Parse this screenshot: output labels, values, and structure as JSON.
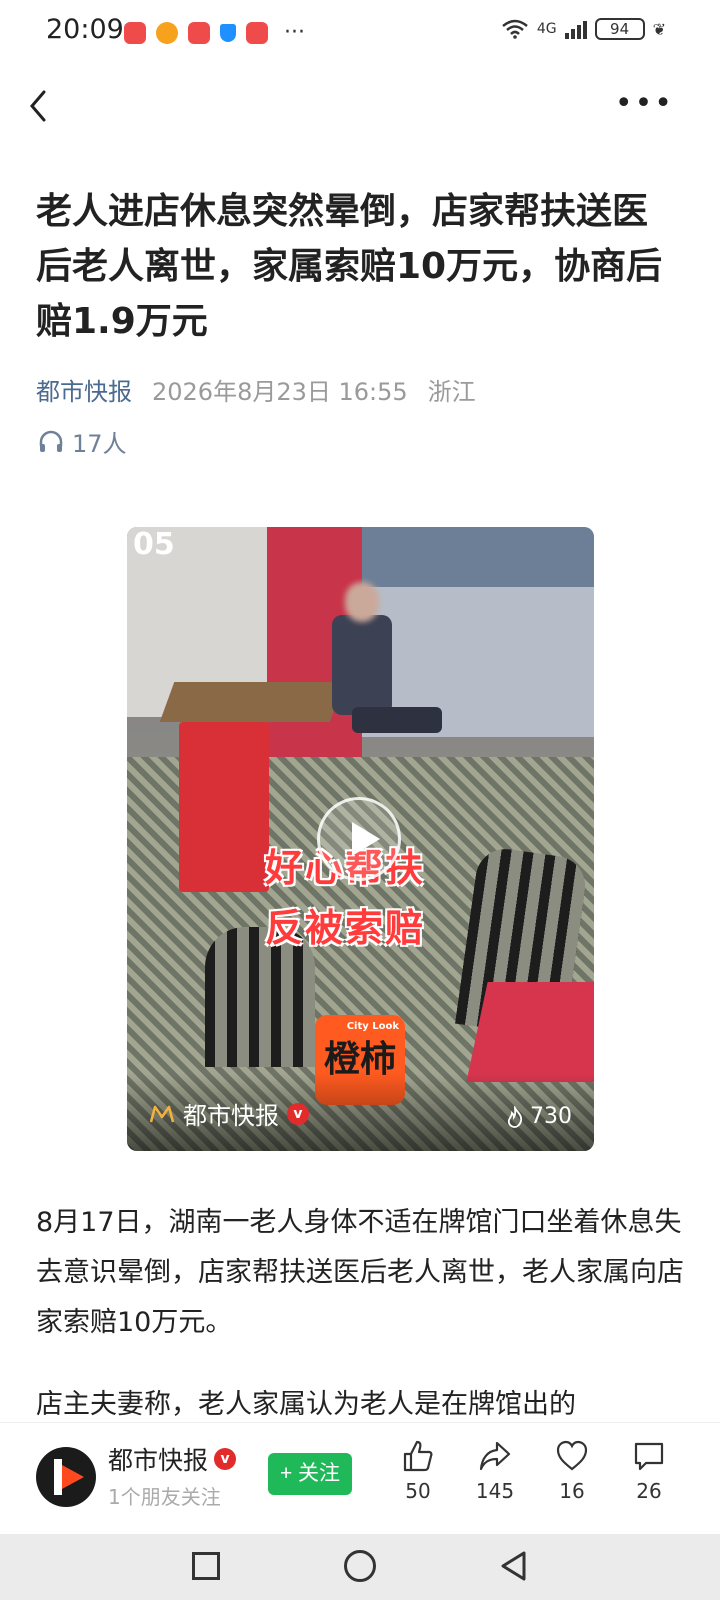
{
  "status_bar": {
    "time": "20:09",
    "dots": "···",
    "network": "4G",
    "battery": "94"
  },
  "article": {
    "title": "老人进店休息突然晕倒，店家帮扶送医后老人离世，家属索赔10万元，协商后赔1.9万元",
    "source": "都市快报",
    "date": "2026年8月23日 16:55",
    "region": "浙江",
    "listeners": "17人"
  },
  "video": {
    "timestamp": "05",
    "overlay_line1": "好心帮扶",
    "overlay_line2": "反被索赔",
    "logo_text": "橙柿",
    "logo_small": "City Look",
    "source": "都市快报",
    "verified": "v",
    "views": "730"
  },
  "body": {
    "paragraph1": "8月17日，湖南一老人身体不适在牌馆门口坐着休息失去意识晕倒，店家帮扶送医后老人离世，老人家属向店家索赔10万元。",
    "paragraph2": "店主夫妻称，老人家属认为老人是在牌馆出的"
  },
  "action_bar": {
    "author_name": "都市快报",
    "verified": "v",
    "author_sub": "1个朋友关注",
    "follow_label": "+ 关注",
    "likes": "50",
    "shares": "145",
    "favorites": "16",
    "comments": "26"
  },
  "colors": {
    "source_blue": "#4b6a8f",
    "follow_green": "#1fb95a",
    "overlay_red": "#ff3b3b"
  },
  "icons": [
    "back-icon",
    "more-icon",
    "headphone-icon",
    "play-icon",
    "like-icon",
    "share-icon",
    "favorite-icon",
    "comment-icon"
  ]
}
